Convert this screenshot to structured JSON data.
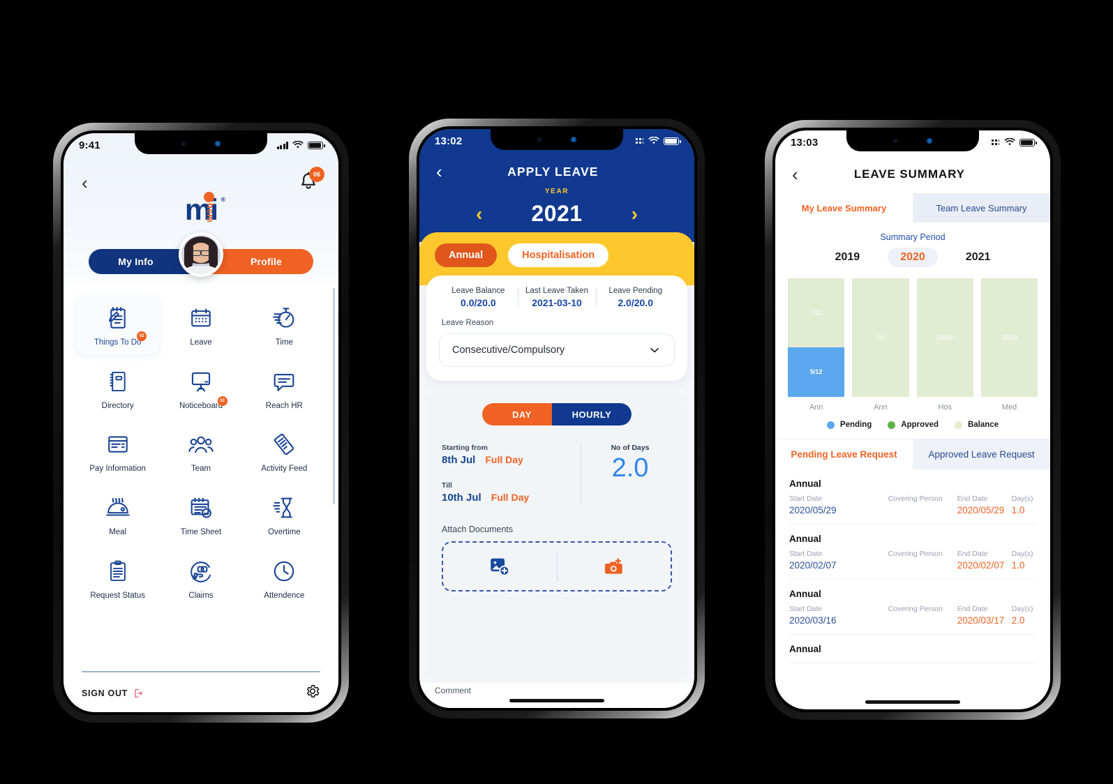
{
  "phone1": {
    "status": {
      "time": "9:41"
    },
    "nav": {
      "back_icon": "chevron-left-icon",
      "bell_icon": "bell-icon",
      "bell_badge": "06"
    },
    "logo": {
      "mark": "mi",
      "sub": "hcm",
      "reg": "®"
    },
    "segments": {
      "left": "My Info",
      "right": "Profile"
    },
    "tiles": [
      {
        "label": "Things To Do",
        "icon": "notepad-pen-icon",
        "badge": "02",
        "active": true
      },
      {
        "label": "Leave",
        "icon": "calendar-icon",
        "badge": "",
        "active": false
      },
      {
        "label": "Time",
        "icon": "stopwatch-icon",
        "badge": "",
        "active": false
      },
      {
        "label": "Directory",
        "icon": "address-book-icon",
        "badge": "",
        "active": false
      },
      {
        "label": "Noticeboard",
        "icon": "board-icon",
        "badge": "02",
        "active": false
      },
      {
        "label": "Reach HR",
        "icon": "speech-bubble-icon",
        "badge": "",
        "active": false
      },
      {
        "label": "Pay Information",
        "icon": "payslip-icon",
        "badge": "",
        "active": false
      },
      {
        "label": "Team",
        "icon": "people-group-icon",
        "badge": "",
        "active": false
      },
      {
        "label": "Activity Feed",
        "icon": "activity-feed-icon",
        "badge": "",
        "active": false
      },
      {
        "label": "Meal",
        "icon": "meal-tray-icon",
        "badge": "",
        "active": false
      },
      {
        "label": "Time Sheet",
        "icon": "calendar-check-icon",
        "badge": "",
        "active": false
      },
      {
        "label": "Overtime",
        "icon": "hourglass-icon",
        "badge": "",
        "active": false
      },
      {
        "label": "Request Status",
        "icon": "clipboard-icon",
        "badge": "",
        "active": false
      },
      {
        "label": "Claims",
        "icon": "money-hand-icon",
        "badge": "",
        "active": false
      },
      {
        "label": "Attendence",
        "icon": "clock-icon",
        "badge": "",
        "active": false
      }
    ],
    "footer": {
      "signout": "SIGN OUT",
      "signout_icon": "logout-icon",
      "settings_icon": "gear-icon"
    }
  },
  "phone2": {
    "status": {
      "time": "13:02"
    },
    "nav": {
      "back_icon": "chevron-left-icon",
      "title": "APPLY LEAVE"
    },
    "year": {
      "label": "YEAR",
      "value": "2021",
      "prev_icon": "chevron-left-icon",
      "next_icon": "chevron-right-icon"
    },
    "leave_types": [
      {
        "label": "Annual",
        "selected": true
      },
      {
        "label": "Hospitalisation",
        "selected": false
      }
    ],
    "stats": [
      {
        "key": "Leave Balance",
        "value": "0.0/20.0"
      },
      {
        "key": "Last Leave Taken",
        "value": "2021-03-10"
      },
      {
        "key": "Leave Pending",
        "value": "2.0/20.0"
      }
    ],
    "reason": {
      "label": "Leave Reason",
      "value": "Consecutive/Compulsory",
      "chevron_icon": "chevron-down-icon"
    },
    "mode_toggle": [
      {
        "label": "DAY",
        "selected": true
      },
      {
        "label": "HOURLY",
        "selected": false
      }
    ],
    "dates": {
      "start_caption": "Starting from",
      "start_date": "8th Jul",
      "start_part": "Full Day",
      "till_caption": "Till",
      "till_date": "10th Jul",
      "till_part": "Full Day"
    },
    "no_of_days": {
      "label": "No of Days",
      "value": "2.0"
    },
    "attach": {
      "label": "Attach Documents",
      "gallery_icon": "add-image-icon",
      "camera_icon": "add-camera-icon"
    },
    "comment": "Comment"
  },
  "phone3": {
    "status": {
      "time": "13:03"
    },
    "nav": {
      "back_icon": "chevron-left-icon",
      "title": "LEAVE SUMMARY"
    },
    "tabs": [
      {
        "label": "My Leave Summary",
        "selected": true
      },
      {
        "label": "Team Leave Summary",
        "selected": false
      }
    ],
    "summary_period": {
      "label": "Summary Period",
      "years": [
        "2019",
        "2020",
        "2021"
      ],
      "selected": "2020"
    },
    "chart_data": {
      "type": "bar",
      "title": "",
      "stacked": true,
      "categories": [
        "Ann",
        "Ann",
        "Hos",
        "Med"
      ],
      "series": [
        {
          "name": "Pending",
          "color": "#5ca8ee",
          "labels": [
            "5/12",
            "",
            "",
            ""
          ],
          "values": [
            5,
            0,
            0,
            0
          ]
        },
        {
          "name": "Approved",
          "color": "#5bb54a",
          "labels": [
            "",
            "",
            "",
            ""
          ],
          "values": [
            0,
            0,
            0,
            0
          ]
        },
        {
          "name": "Balance",
          "color": "#e2ecd2",
          "labels": [
            "7/12",
            "1/1",
            "50/50",
            "20/20"
          ],
          "values": [
            7,
            1,
            50,
            20
          ]
        }
      ],
      "legend": [
        "Pending",
        "Approved",
        "Balance"
      ],
      "legend_position": "bottom",
      "grid": false,
      "xlabel": "",
      "ylabel": ""
    },
    "request_tabs": [
      {
        "label": "Pending Leave Request",
        "selected": true
      },
      {
        "label": "Approved Leave Request",
        "selected": false
      }
    ],
    "request_columns": [
      "Start Date",
      "Covering Person",
      "End Date",
      "Day(s)"
    ],
    "requests": [
      {
        "type": "Annual",
        "start": "2020/05/29",
        "covering": "",
        "end": "2020/05/29",
        "days": "1.0"
      },
      {
        "type": "Annual",
        "start": "2020/02/07",
        "covering": "",
        "end": "2020/02/07",
        "days": "1.0"
      },
      {
        "type": "Annual",
        "start": "2020/03/16",
        "covering": "",
        "end": "2020/03/17",
        "days": "2.0"
      },
      {
        "type": "Annual",
        "start": "",
        "covering": "",
        "end": "",
        "days": ""
      }
    ]
  }
}
